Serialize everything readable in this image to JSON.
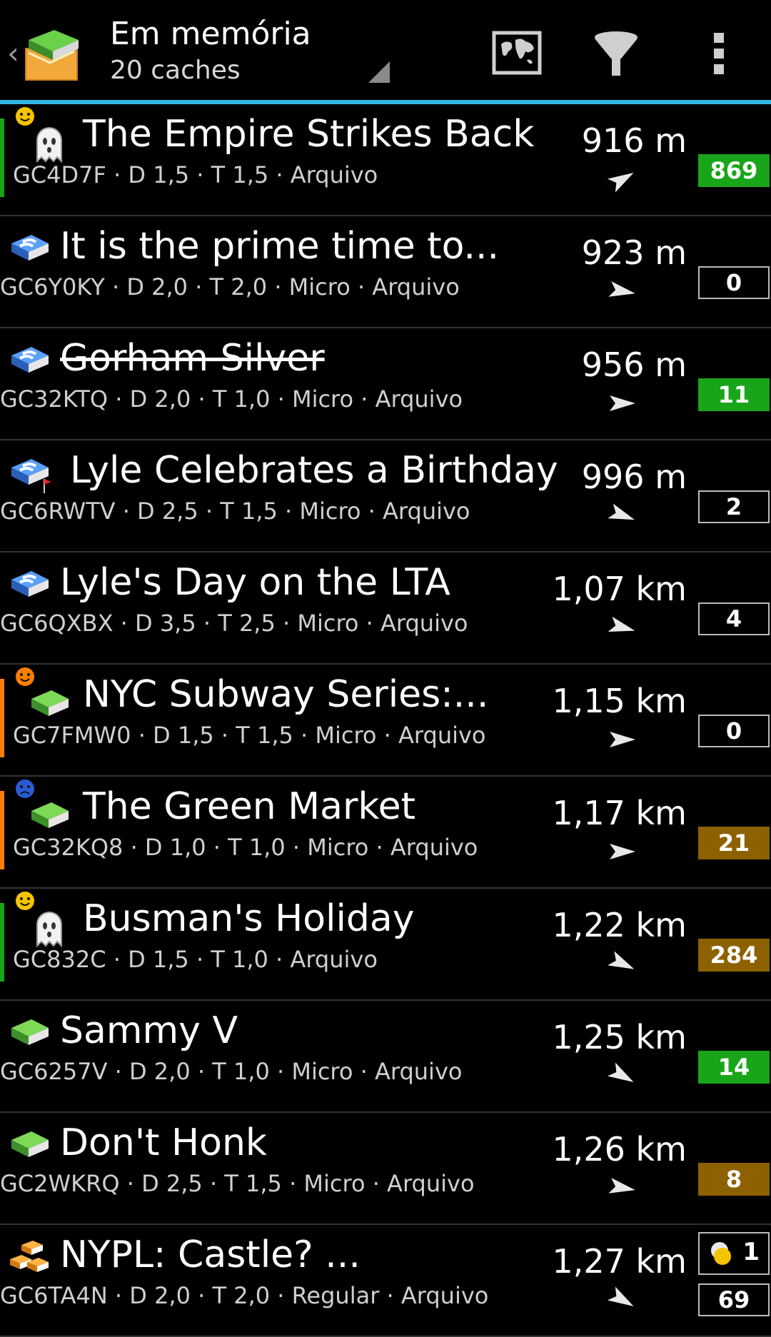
{
  "header": {
    "title": "Em memória",
    "subtitle": "20 caches",
    "accent_color": "#33b5e5",
    "icons": [
      "back-caret-icon",
      "app-logo-icon",
      "map-icon",
      "filter-icon",
      "overflow-menu-icon"
    ]
  },
  "caches": [
    {
      "name": "The Empire Strikes Back",
      "info": "GC4D7F · D 1,5 · T 1,5 · Arquivo",
      "distance": "916 m",
      "count": "869",
      "badge": "green",
      "status": "green",
      "smiley": "yellow",
      "icon": "ghost-icon",
      "strike": false
    },
    {
      "name": "It is the prime time to...",
      "info": "GC6Y0KY · D 2,0 · T 2,0 · Micro · Arquivo",
      "distance": "923 m",
      "count": "0",
      "badge": "plain",
      "status": "",
      "smiley": "",
      "icon": "multi-cache-icon",
      "strike": false
    },
    {
      "name": "Gorham Silver",
      "info": "GC32KTQ · D 2,0 · T 1,0 · Micro · Arquivo",
      "distance": "956 m",
      "count": "11",
      "badge": "green",
      "status": "",
      "smiley": "",
      "icon": "multi-cache-icon",
      "strike": true
    },
    {
      "name": "Lyle Celebrates a Birthday",
      "info": "GC6RWTV · D 2,5 · T 1,5 · Micro · Arquivo",
      "distance": "996 m",
      "count": "2",
      "badge": "plain",
      "status": "",
      "smiley": "",
      "icon": "multi-cache-flag-icon",
      "strike": false
    },
    {
      "name": "Lyle's Day on the LTA",
      "info": "GC6QXBX · D 3,5 · T 2,5 · Micro · Arquivo",
      "distance": "1,07 km",
      "count": "4",
      "badge": "plain",
      "status": "",
      "smiley": "",
      "icon": "multi-cache-icon",
      "strike": false
    },
    {
      "name": "NYC Subway Series:...",
      "info": "GC7FMW0 · D 1,5 · T 1,5 · Micro · Arquivo",
      "distance": "1,15 km",
      "count": "0",
      "badge": "plain",
      "status": "orange",
      "smiley": "orange",
      "icon": "traditional-cache-icon",
      "strike": false
    },
    {
      "name": "The Green Market",
      "info": "GC32KQ8 · D 1,0 · T 1,0 · Micro · Arquivo",
      "distance": "1,17 km",
      "count": "21",
      "badge": "gold",
      "status": "orange",
      "smiley": "blue",
      "icon": "traditional-cache-icon",
      "strike": false
    },
    {
      "name": "Busman's Holiday",
      "info": "GC832C · D 1,5 · T 1,0 · Arquivo",
      "distance": "1,22 km",
      "count": "284",
      "badge": "gold",
      "status": "green",
      "smiley": "yellow",
      "icon": "ghost-icon",
      "strike": false
    },
    {
      "name": "Sammy V",
      "info": "GC6257V · D 2,0 · T 1,0 · Micro · Arquivo",
      "distance": "1,25 km",
      "count": "14",
      "badge": "green",
      "status": "",
      "smiley": "",
      "icon": "traditional-cache-icon",
      "strike": false
    },
    {
      "name": "Don't Honk",
      "info": "GC2WKRQ · D 2,5 · T 1,5 · Micro · Arquivo",
      "distance": "1,26 km",
      "count": "8",
      "badge": "gold",
      "status": "",
      "smiley": "",
      "icon": "traditional-cache-icon",
      "strike": false
    },
    {
      "name": "NYPL: Castle? ...",
      "info": "GC6TA4N · D 2,0 · T 2,0 · Regular · Arquivo",
      "distance": "1,27 km",
      "count": "69",
      "badge": "plain",
      "status": "",
      "smiley": "",
      "icon": "event-cache-icon",
      "strike": false,
      "coins": "1"
    }
  ],
  "colors": {
    "green": "#19a519",
    "orange": "#ff7f00",
    "gold": "#8e6100",
    "yellow": "#f5c400",
    "blue": "#2a5bd7"
  }
}
